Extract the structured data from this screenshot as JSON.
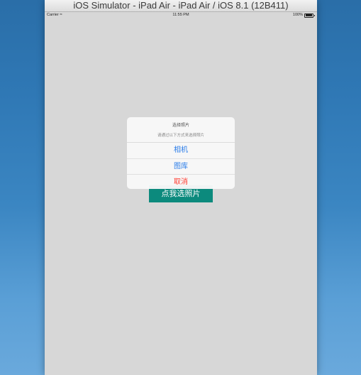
{
  "window": {
    "title": "iOS Simulator - iPad Air - iPad Air / iOS 8.1 (12B411)"
  },
  "status_bar": {
    "carrier": "Carrier",
    "time": "11:55 PM",
    "battery_percent": "100%"
  },
  "main": {
    "select_button_label": "点我选照片"
  },
  "alert": {
    "title": "选择照片",
    "message": "请通过以下方式来选择照片",
    "actions": [
      "相机",
      "图库",
      "取消"
    ]
  },
  "colors": {
    "button_bg": "#0c8a7d",
    "action_blue": "#2b7de9",
    "cancel_red": "#ff3b30"
  }
}
